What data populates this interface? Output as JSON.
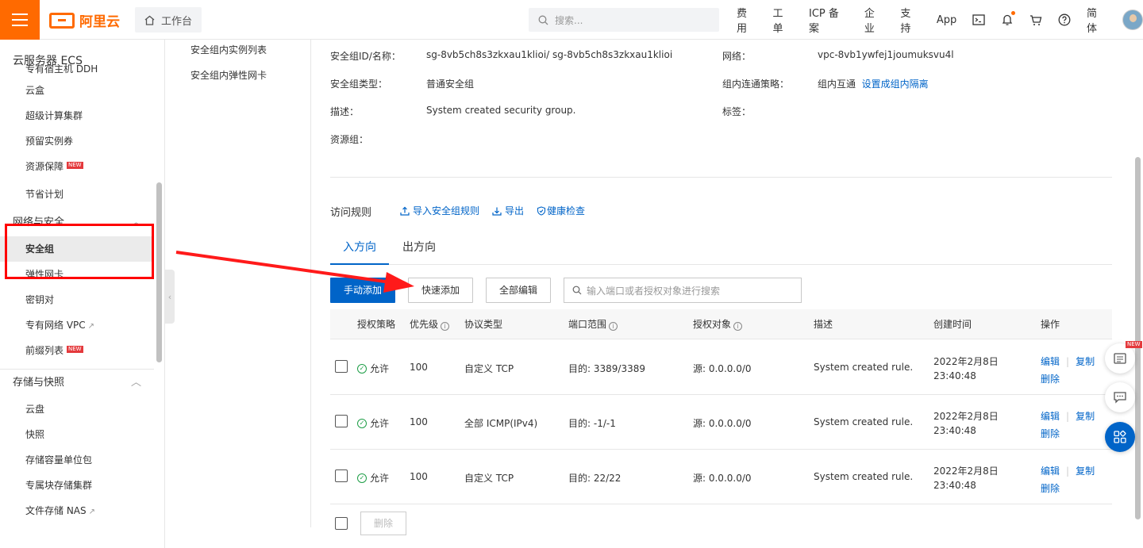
{
  "topbar": {
    "brand": "阿里云",
    "workbench": "工作台",
    "search_placeholder": "搜索...",
    "nav": [
      "费用",
      "工单",
      "ICP 备案",
      "企业",
      "支持",
      "App"
    ],
    "lang": "简体"
  },
  "sidebar": {
    "title": "云服务器 ECS",
    "items_top": [
      {
        "label": "专有宿主机 DDH"
      },
      {
        "label": "云盒"
      },
      {
        "label": "超级计算集群"
      },
      {
        "label": "预留实例券"
      },
      {
        "label": "资源保障",
        "new": "NEW"
      },
      {
        "label": "节省计划"
      }
    ],
    "group_network": "网络与安全",
    "items_network": [
      {
        "label": "安全组"
      },
      {
        "label": "弹性网卡"
      },
      {
        "label": "密钥对"
      },
      {
        "label": "专有网络 VPC"
      },
      {
        "label": "前缀列表",
        "new": "NEW"
      }
    ],
    "group_storage": "存储与快照",
    "items_storage": [
      {
        "label": "云盘"
      },
      {
        "label": "快照"
      },
      {
        "label": "存储容量单位包"
      },
      {
        "label": "专属块存储集群"
      },
      {
        "label": "文件存储 NAS"
      }
    ]
  },
  "subnav": {
    "items": [
      "安全组内实例列表",
      "安全组内弹性网卡"
    ]
  },
  "info": {
    "id_label": "安全组ID/名称：",
    "id_value": "sg-8vb5ch8s3zkxau1klioi/ sg-8vb5ch8s3zkxau1klioi",
    "type_label": "安全组类型：",
    "type_value": "普通安全组",
    "desc_label": "描述：",
    "desc_value": "System created security group.",
    "rg_label": "资源组：",
    "net_label": "网络：",
    "net_value": "vpc-8vb1ywfej1joumuksvu4l",
    "policy_label": "组内连通策略：",
    "policy_value": "组内互通",
    "policy_link": "设置成组内隔离",
    "tag_label": "标签："
  },
  "rules": {
    "title": "访问规则",
    "import": "导入安全组规则",
    "export": "导出",
    "health": "健康检查",
    "tab_in": "入方向",
    "tab_out": "出方向",
    "btn_manual": "手动添加",
    "btn_quick": "快速添加",
    "btn_edit_all": "全部编辑",
    "filter_placeholder": "输入端口或者授权对象进行搜索",
    "columns": [
      "授权策略",
      "优先级",
      "协议类型",
      "端口范围",
      "授权对象",
      "描述",
      "创建时间",
      "操作"
    ],
    "rows": [
      {
        "policy": "允许",
        "priority": "100",
        "protocol": "自定义 TCP",
        "port": "目的: 3389/3389",
        "source": "源: 0.0.0.0/0",
        "desc": "System created rule.",
        "date": "2022年2月8日",
        "time": "23:40:48",
        "edit": "编辑",
        "copy": "复制",
        "delete": "删除"
      },
      {
        "policy": "允许",
        "priority": "100",
        "protocol": "全部 ICMP(IPv4)",
        "port": "目的: -1/-1",
        "source": "源: 0.0.0.0/0",
        "desc": "System created rule.",
        "date": "2022年2月8日",
        "time": "23:40:48",
        "edit": "编辑",
        "copy": "复制",
        "delete": "删除"
      },
      {
        "policy": "允许",
        "priority": "100",
        "protocol": "自定义 TCP",
        "port": "目的: 22/22",
        "source": "源: 0.0.0.0/0",
        "desc": "System created rule.",
        "date": "2022年2月8日",
        "time": "23:40:48",
        "edit": "编辑",
        "copy": "复制",
        "delete": "删除"
      }
    ],
    "btn_delete": "删除"
  },
  "float": {
    "new": "NEW"
  }
}
